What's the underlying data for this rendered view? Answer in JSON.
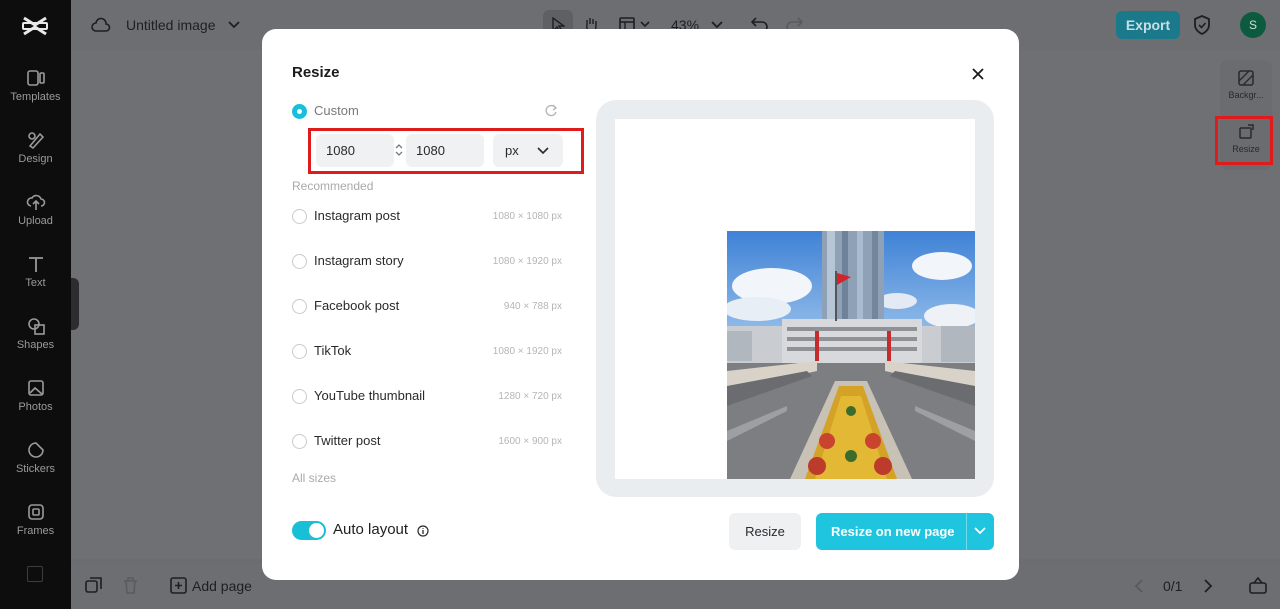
{
  "app": {
    "title": "Untitled image",
    "zoom": "43%",
    "export_label": "Export",
    "avatar_letter": "S"
  },
  "sidebar": {
    "items": [
      {
        "label": "Templates",
        "icon": "templates-icon"
      },
      {
        "label": "Design",
        "icon": "design-icon"
      },
      {
        "label": "Upload",
        "icon": "upload-icon"
      },
      {
        "label": "Text",
        "icon": "text-icon"
      },
      {
        "label": "Shapes",
        "icon": "shapes-icon"
      },
      {
        "label": "Photos",
        "icon": "photos-icon"
      },
      {
        "label": "Stickers",
        "icon": "stickers-icon"
      },
      {
        "label": "Frames",
        "icon": "frames-icon"
      }
    ]
  },
  "right_panel": {
    "items": [
      {
        "label": "Backgr...",
        "icon": "background-icon"
      },
      {
        "label": "Resize",
        "icon": "resize-icon"
      }
    ]
  },
  "bottom": {
    "add_page": "Add page",
    "page_counter": "0/1"
  },
  "modal": {
    "title": "Resize",
    "custom_label": "Custom",
    "width_value": "1080",
    "height_value": "1080",
    "unit": "px",
    "recommended_label": "Recommended",
    "options": [
      {
        "label": "Instagram post",
        "size": "1080 × 1080 px"
      },
      {
        "label": "Instagram story",
        "size": "1080 × 1920 px"
      },
      {
        "label": "Facebook post",
        "size": "940 × 788 px"
      },
      {
        "label": "TikTok",
        "size": "1080 × 1920 px"
      },
      {
        "label": "YouTube thumbnail",
        "size": "1280 × 720 px"
      },
      {
        "label": "Twitter post",
        "size": "1600 × 900 px"
      }
    ],
    "all_sizes_label": "All sizes",
    "auto_layout_label": "Auto layout",
    "auto_layout_on": true,
    "resize_label": "Resize",
    "resize_new_page_label": "Resize on new page"
  },
  "colors": {
    "accent": "#1fc5de",
    "highlight": "#e01b1b",
    "export": "#1a7a8c"
  }
}
